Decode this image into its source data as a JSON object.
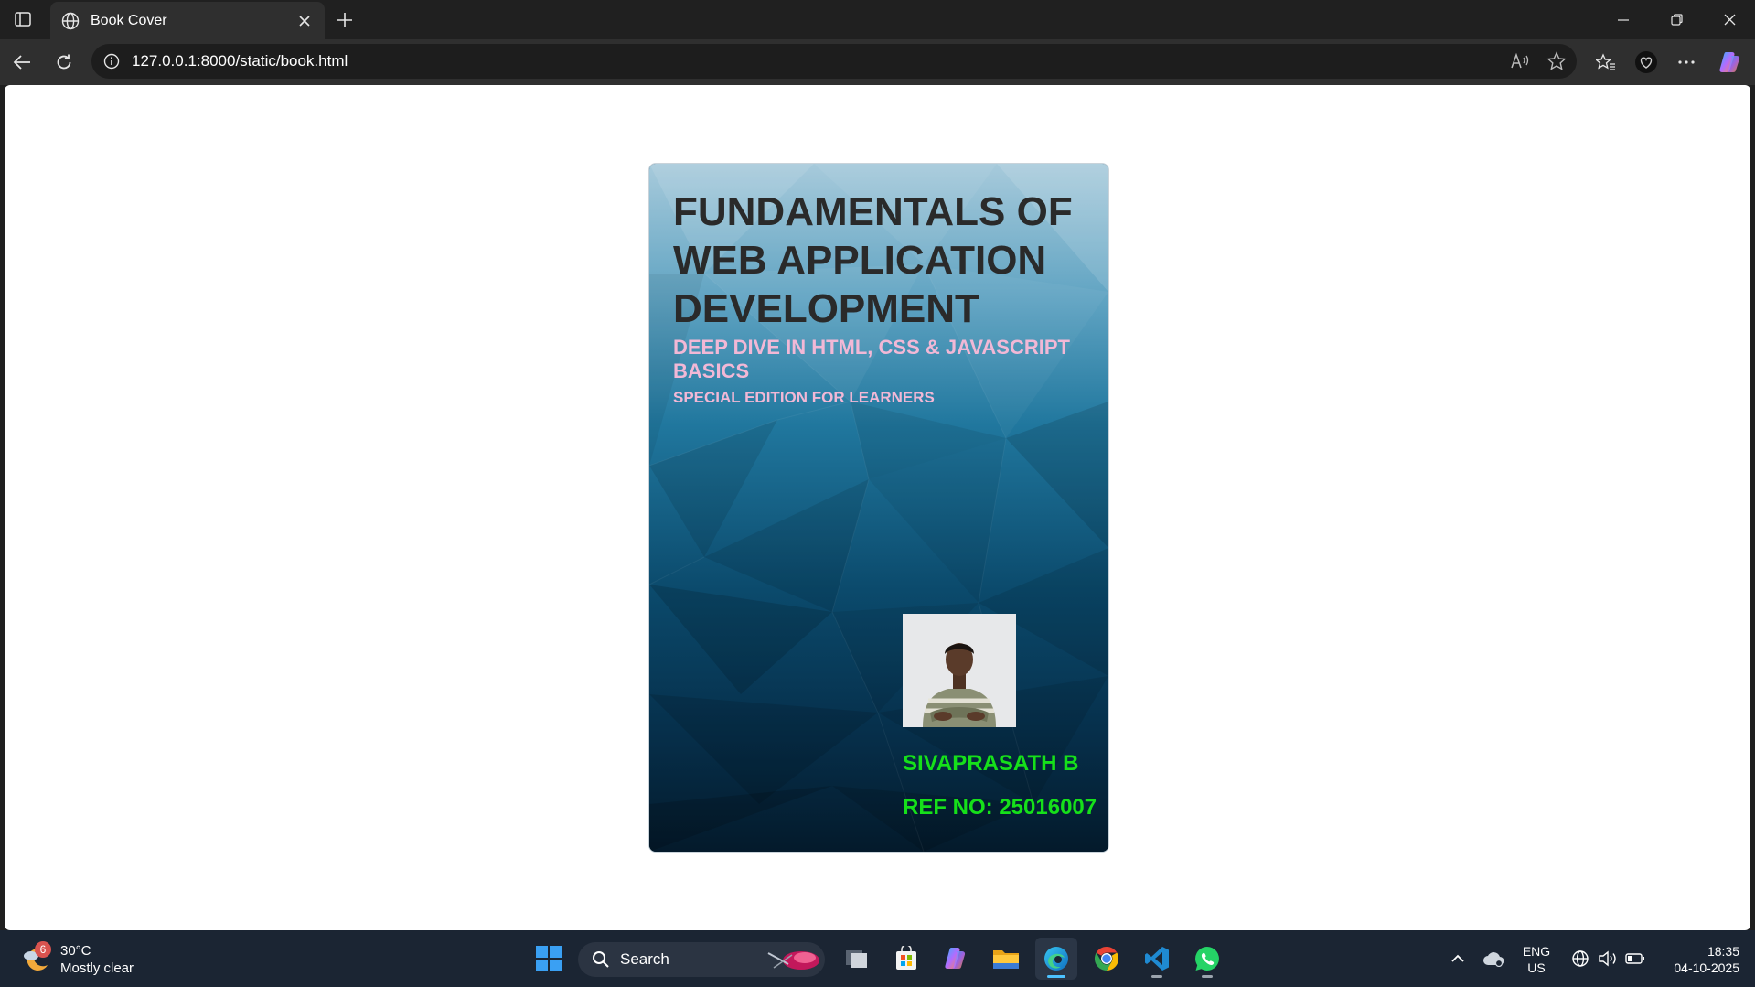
{
  "browser": {
    "tab_title": "Book Cover",
    "url": "127.0.0.1:8000/static/book.html"
  },
  "cover": {
    "title": "FUNDAMENTALS OF WEB APPLICATION DEVELOPMENT",
    "subtitle": "DEEP DIVE IN HTML, CSS & JAVASCRIPT BASICS",
    "edition": "SPECIAL EDITION FOR LEARNERS",
    "author": "SIVAPRASATH B",
    "ref": "REF NO: 25016007",
    "colors": {
      "title": "#2a2a2a",
      "subtitle": "#f2b8d6",
      "author": "#16e01a",
      "background_top": "#a7cadb",
      "background_bottom": "#041a2b"
    }
  },
  "taskbar": {
    "weather": {
      "badge": "6",
      "temperature": "30°C",
      "condition": "Mostly clear"
    },
    "search_label": "Search",
    "apps": [
      "task-view",
      "microsoft-store",
      "copilot",
      "file-explorer",
      "edge",
      "chrome",
      "vscode",
      "whatsapp"
    ],
    "language": "ENG",
    "region": "US",
    "time": "18:35",
    "date": "04-10-2025"
  }
}
